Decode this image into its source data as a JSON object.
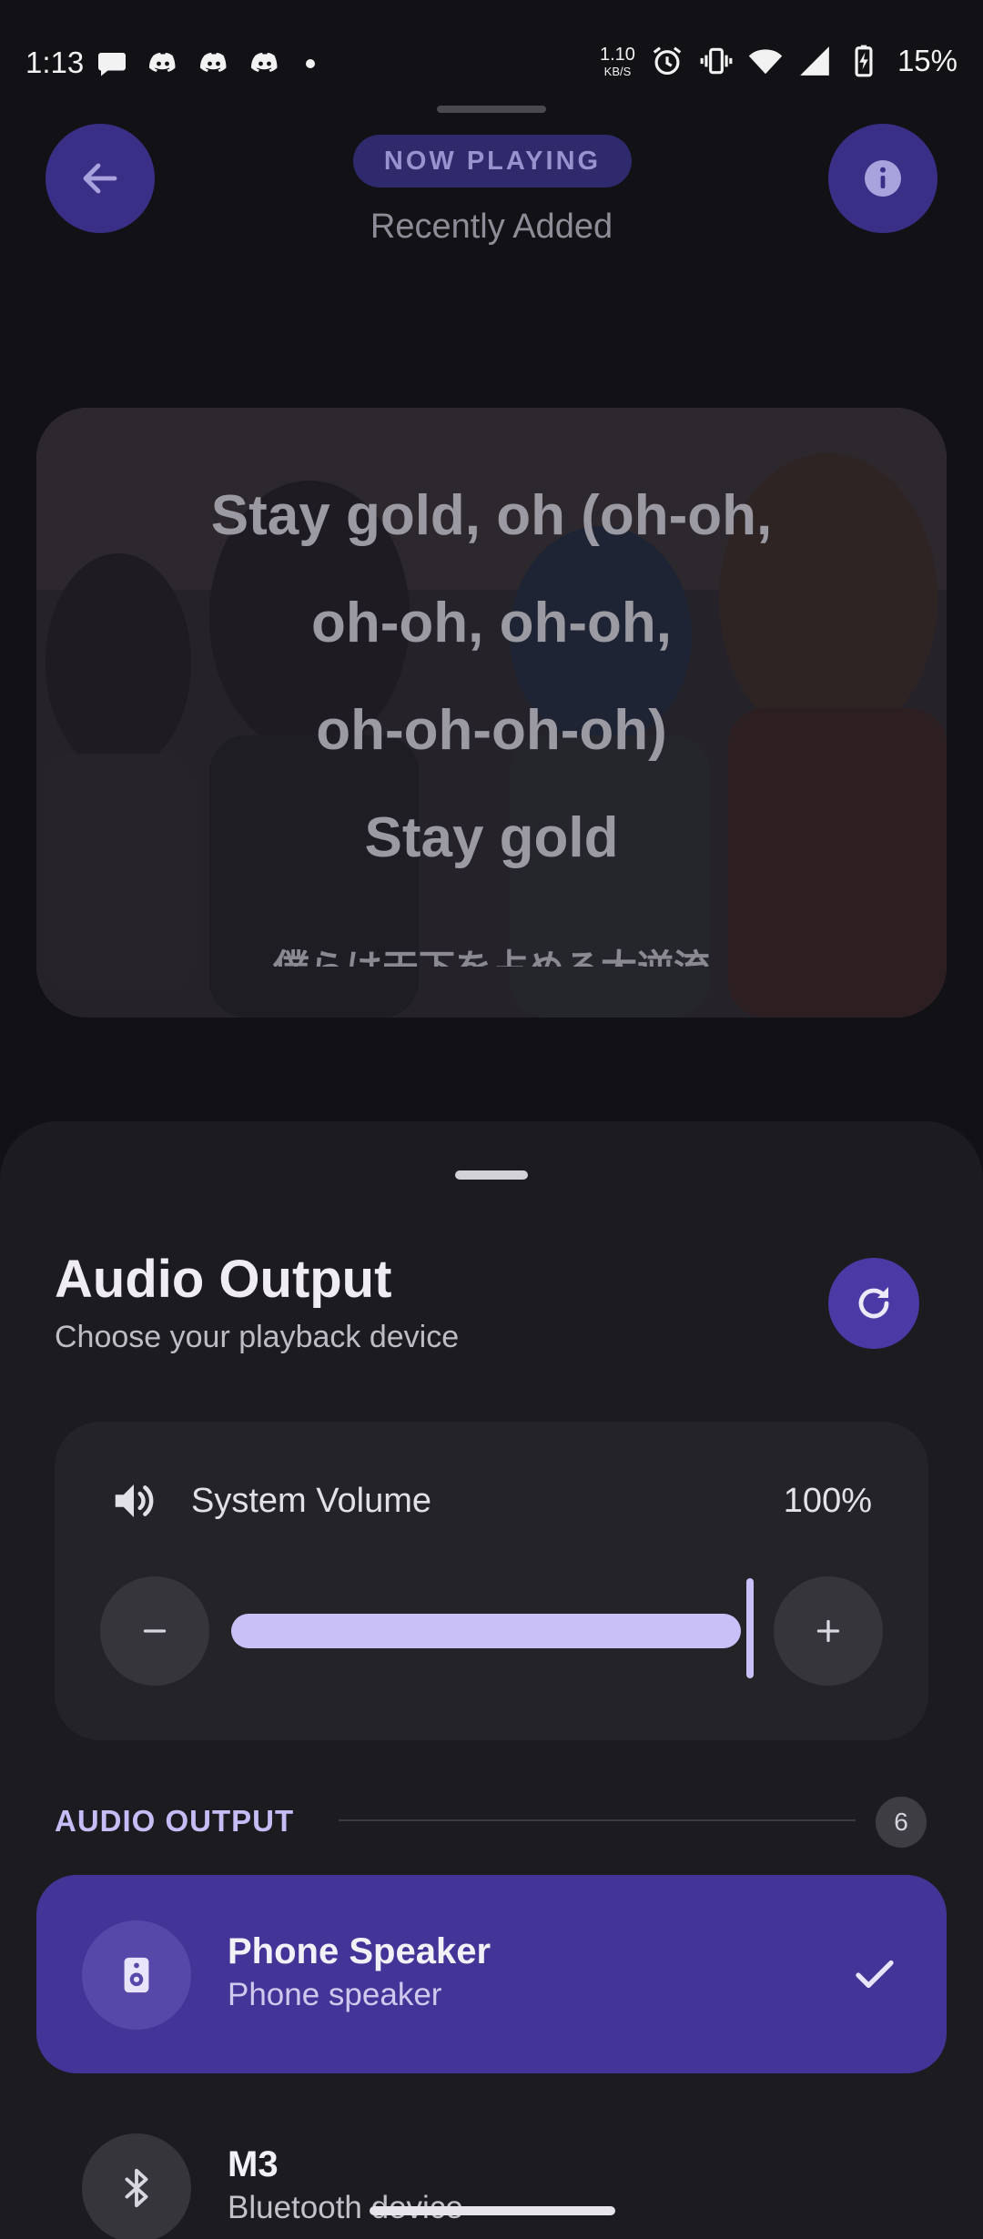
{
  "status_bar": {
    "time": "1:13",
    "net_speed_value": "1.10",
    "net_speed_unit": "KB/S",
    "battery": "15%",
    "notification_icons": [
      "chat-bubble-icon",
      "discord-icon",
      "discord-icon",
      "discord-icon",
      "more-dot-icon"
    ],
    "system_icons": [
      "alarm-icon",
      "vibrate-icon",
      "wifi-icon",
      "cell-signal-icon",
      "battery-charging-icon"
    ]
  },
  "header": {
    "badge": "NOW PLAYING",
    "subtitle": "Recently Added"
  },
  "lyrics": {
    "lines": [
      "Stay gold, oh (oh-oh,",
      "oh-oh, oh-oh,",
      "oh-oh-oh-oh)",
      "Stay gold"
    ],
    "next_line_partial": "僕らは天下を占める大逆流"
  },
  "audio_sheet": {
    "title": "Audio Output",
    "subtitle": "Choose your playback device",
    "volume": {
      "label": "System Volume",
      "value_text": "100%",
      "level": 1.0
    },
    "section": {
      "label": "AUDIO OUTPUT",
      "count": "6"
    },
    "devices": [
      {
        "name": "Phone Speaker",
        "description": "Phone speaker",
        "icon": "speaker-icon",
        "selected": true
      },
      {
        "name": "M3",
        "description": "Bluetooth device",
        "icon": "bluetooth-icon",
        "selected": false
      }
    ]
  },
  "colors": {
    "background": "#121216",
    "sheet": "#1b1b20",
    "accent": "#433598",
    "accent_light": "#c9c0f8",
    "button_purple": "#3a2f86"
  }
}
